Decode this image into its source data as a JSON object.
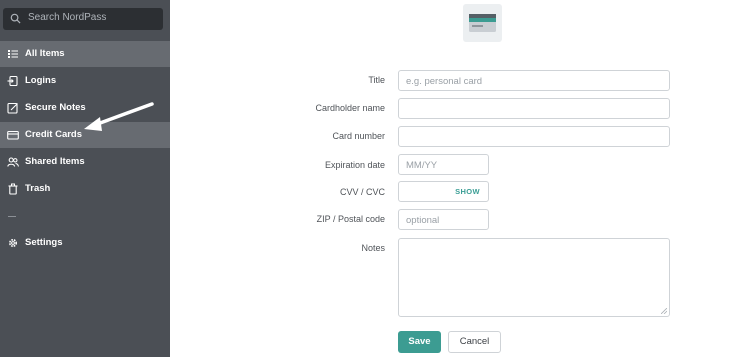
{
  "search": {
    "placeholder": "Search NordPass"
  },
  "sidebar": {
    "items": [
      {
        "label": "All Items",
        "icon": "list-icon"
      },
      {
        "label": "Logins",
        "icon": "login-icon"
      },
      {
        "label": "Secure Notes",
        "icon": "note-icon"
      },
      {
        "label": "Credit Cards",
        "icon": "credit-card-icon"
      },
      {
        "label": "Shared Items",
        "icon": "users-icon"
      },
      {
        "label": "Trash",
        "icon": "trash-icon"
      },
      {
        "label": "Settings",
        "icon": "gear-icon"
      }
    ]
  },
  "form": {
    "title": {
      "label": "Title",
      "placeholder": "e.g. personal card"
    },
    "cardholder": {
      "label": "Cardholder name",
      "placeholder": ""
    },
    "card_number": {
      "label": "Card number",
      "placeholder": ""
    },
    "expiration": {
      "label": "Expiration date",
      "placeholder": "MM/YY"
    },
    "cvv": {
      "label": "CVV / CVC",
      "show_label": "SHOW"
    },
    "zip": {
      "label": "ZIP / Postal code",
      "placeholder": "optional"
    },
    "notes": {
      "label": "Notes",
      "placeholder": ""
    }
  },
  "actions": {
    "save_label": "Save",
    "cancel_label": "Cancel"
  },
  "colors": {
    "sidebar_bg": "#4b4f55",
    "active_item": "#676b71",
    "accent": "#3c9c92"
  }
}
